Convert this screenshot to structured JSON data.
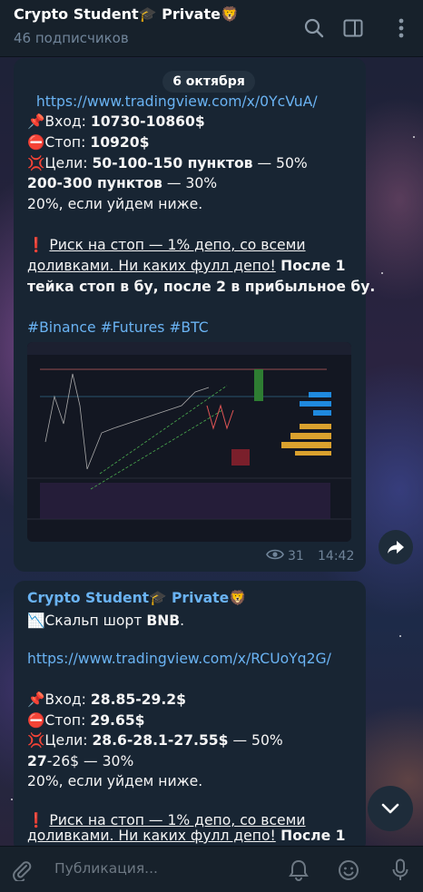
{
  "header": {
    "title": "Crypto Student🎓 Private🦁",
    "subtitle": "46 подписчиков"
  },
  "date_pill": "6 октября",
  "message1": {
    "link": "https://www.tradingview.com/x/0YcVuA/",
    "entry_label": "Вход: ",
    "entry_value": "10730-10860$",
    "stop_label": "Стоп: ",
    "stop_value": "10920$",
    "targets_label": "Цели: ",
    "targets_value": "50-100-150 пунктов",
    "targets_pct": " — 50%",
    "targets2_value": "200-300 пунктов",
    "targets2_pct": " — 30%",
    "rest": "20%, если уйдем ниже.",
    "risk_underlined_1": "Риск на стоп — 1% депо, со всеми",
    "risk_underlined_2": "доливками. Ни каких фулл депо!",
    "after_bold_1": " После 1",
    "after_bold_2": "тейка стоп в бу, после 2 в прибыльное бу.",
    "hashtags": "#Binance #Futures #BTC",
    "views": "31",
    "time": "14:42"
  },
  "message2": {
    "sender": "Crypto Student🎓 Private🦁",
    "headline_prefix": "Скальп шорт ",
    "headline_bold": "BNB",
    "headline_suffix": ".",
    "link": "https://www.tradingview.com/x/RCUoYq2G/",
    "entry_label": "Вход: ",
    "entry_value": "28.85-29.2$",
    "stop_label": "Стоп: ",
    "stop_value": "29.65$",
    "targets_label": "Цели: ",
    "targets_value": "28.6-28.1-27.55$",
    "targets_pct": " — 50%",
    "targets2_value": "27",
    "targets2_suffix": "-26$ — 30%",
    "rest": "20%, если уйдем ниже.",
    "risk_underlined_1": "Риск на стоп — 1% депо, со всеми",
    "risk_underlined_2": "доливками. Ни каких фулл депо!",
    "after_bold_1": " После 1"
  },
  "input": {
    "placeholder": "Публикация..."
  },
  "icons": {
    "search": "search-icon",
    "sidebar": "sidebar-panel-icon",
    "menu": "more-vertical-icon",
    "share": "share-arrow-icon",
    "scroll": "chevron-down-icon",
    "attach": "paperclip-icon",
    "bell": "bell-icon",
    "emoji": "emoji-icon",
    "mic": "microphone-icon",
    "eye": "eye-icon"
  },
  "colors": {
    "link": "#6ab3f3",
    "bubble": "#182533",
    "header": "#17212b"
  }
}
